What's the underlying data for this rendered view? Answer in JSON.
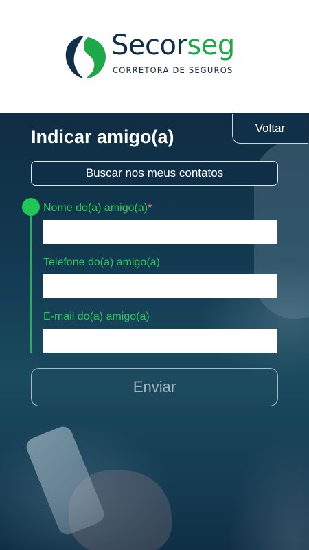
{
  "brand": {
    "name_part1": "Secor",
    "name_part2": "seg",
    "tagline": "CORRETORA DE SEGUROS",
    "colors": {
      "navy": "#0f2f4a",
      "green": "#1ea84a"
    }
  },
  "header": {
    "title": "Indicar amigo(a)",
    "back_label": "Voltar"
  },
  "contacts_button_label": "Buscar nos meus contatos",
  "form": {
    "fields": [
      {
        "label": "Nome do(a) amigo(a)",
        "required_mark": "*",
        "value": "",
        "placeholder": ""
      },
      {
        "label": "Telefone do(a) amigo(a)",
        "value": "",
        "placeholder": ""
      },
      {
        "label": "E-mail do(a) amigo(a)",
        "value": "",
        "placeholder": ""
      }
    ],
    "submit_label": "Enviar"
  },
  "colors": {
    "accent_green": "#1fc855",
    "required_pink": "#ff6f8a",
    "background_dark": "#0f2d43"
  }
}
